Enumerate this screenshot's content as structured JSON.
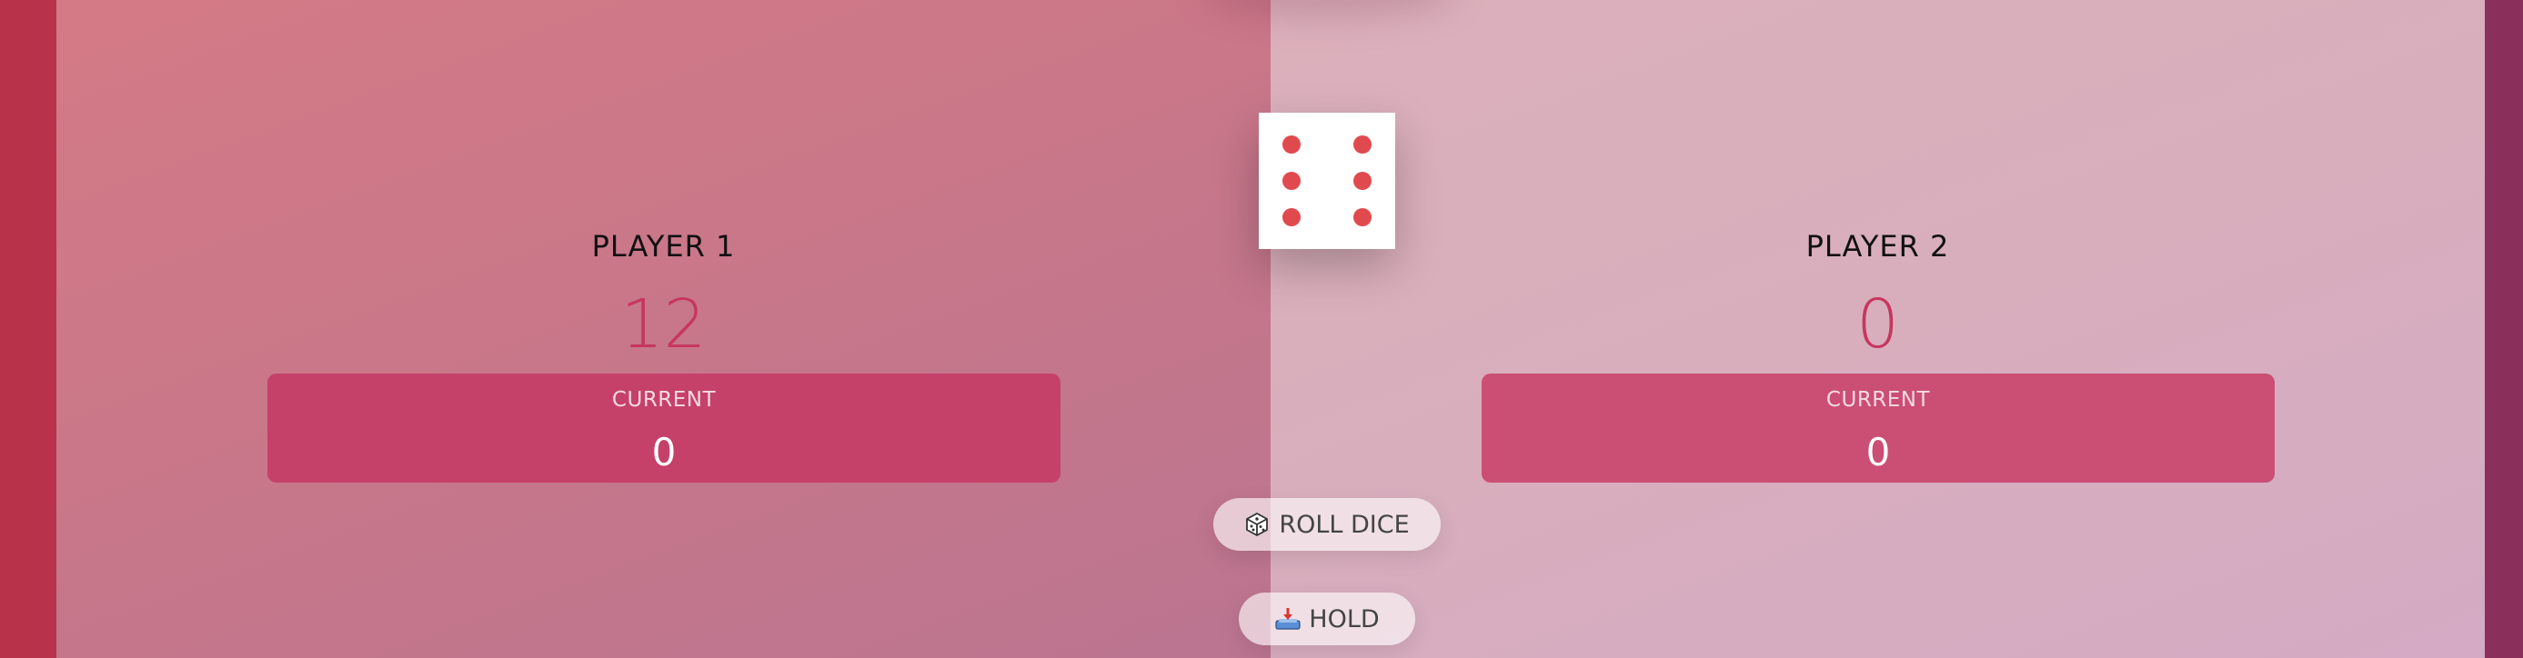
{
  "players": [
    {
      "name": "PLAYER 1",
      "score": "12",
      "current_label": "CURRENT",
      "current_score": "0",
      "active": true
    },
    {
      "name": "PLAYER 2",
      "score": "0",
      "current_label": "CURRENT",
      "current_score": "0",
      "active": false
    }
  ],
  "dice": {
    "value": 6,
    "icon": "dice-six-icon"
  },
  "buttons": {
    "roll_label": "ROLL DICE",
    "roll_icon": "dice-icon",
    "hold_label": "HOLD",
    "hold_icon": "inbox-tray-icon"
  },
  "colors": {
    "score": "#c7365f",
    "current_panel": "#c6416a",
    "pip": "#e04a4e"
  }
}
